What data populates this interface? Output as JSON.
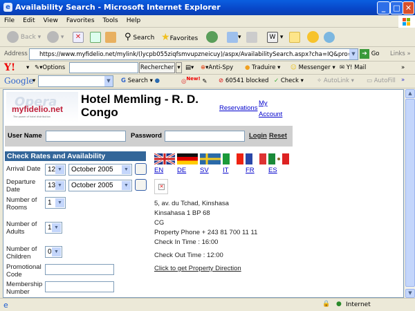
{
  "window": {
    "title": "Availability Search - Microsoft Internet Explorer"
  },
  "menu": [
    "File",
    "Edit",
    "View",
    "Favorites",
    "Tools",
    "Help"
  ],
  "toolbar": {
    "back": "Back",
    "search": "Search",
    "favorites": "Favorites"
  },
  "address": {
    "label": "Address",
    "url": "https://www.myfidelio.net/mylink/(lycpb055ziqfsmvupzneicuy)/aspx/AvailabilitySearch.aspx?cha=IQ&pro=MEML&src=CD&",
    "go": "Go",
    "links": "Links"
  },
  "yahoo": {
    "options": "Options",
    "search_button": "Rechercher",
    "antispy": "Anti-Spy",
    "translate": "Traduire",
    "messenger": "Messenger",
    "mail": "Y! Mail"
  },
  "google": {
    "logo": "Google",
    "search": "Search",
    "new_badge": "New!",
    "blocked": "60541 blocked",
    "check": "Check",
    "autolink": "AutoLink",
    "autofill": "AutoFill"
  },
  "page": {
    "logo_text": "myfidelio.net",
    "logo_tagline": "The power of hotel distribution",
    "hotel_title_line1": "Hotel Memling - R. D.",
    "hotel_title_line2": "Congo",
    "reservations": "Reservations",
    "my": "My",
    "account": "Account",
    "login": {
      "username_label": "User Name",
      "password_label": "Password",
      "login": "Login",
      "reset": "Reset"
    },
    "form": {
      "header": "Check Rates and Availability",
      "arrival_label": "Arrival Date",
      "arrival_day": "12",
      "arrival_month": "October 2005",
      "departure_label1": "Departure",
      "departure_label2": "Date",
      "departure_day": "13",
      "departure_month": "October 2005",
      "rooms_label1": "Number of",
      "rooms_label2": "Rooms",
      "rooms": "1",
      "adults_label1": "Number of",
      "adults_label2": "Adults",
      "adults": "1",
      "children_label1": "Number of",
      "children_label2": "Children",
      "children": "0",
      "promo_label1": "Promotional",
      "promo_label2": "Code",
      "member_label1": "Membership",
      "member_label2": "Number"
    },
    "languages": [
      "EN",
      "DE",
      "SV",
      "IT",
      "FR",
      "ES"
    ],
    "address_lines": [
      "5, av. du Tchad, Kinshasa",
      "Kinsahasa 1 BP 68",
      "CG",
      "Property Phone + 243 81 700 11 11",
      "Check In Time : 16:00",
      "Check Out Time : 12:00"
    ],
    "direction_link": "Click to get Property Direction"
  },
  "status": {
    "zone": "Internet"
  }
}
